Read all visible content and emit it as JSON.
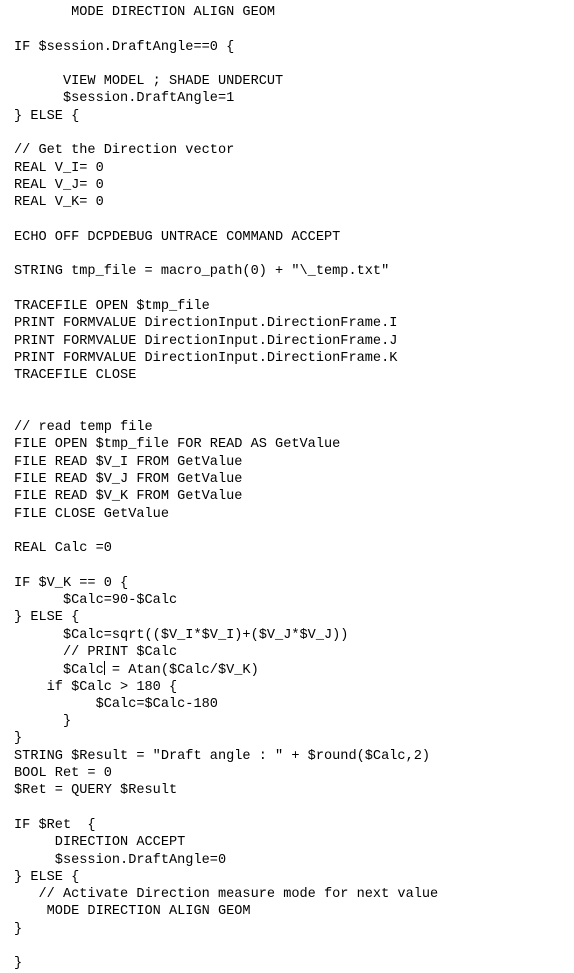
{
  "editor": {
    "kind": "plain-text-code-listing",
    "language": "CAD macro script",
    "foreground_color": "#000000",
    "background_color": "#ffffff",
    "caret": {
      "visible": true,
      "line_index": 38,
      "after_text": "$Calc"
    },
    "lines": [
      "       MODE DIRECTION ALIGN GEOM",
      "",
      "IF $session.DraftAngle==0 {",
      "",
      "      VIEW MODEL ; SHADE UNDERCUT",
      "      $session.DraftAngle=1",
      "} ELSE {",
      "",
      "// Get the Direction vector",
      "REAL V_I= 0",
      "REAL V_J= 0",
      "REAL V_K= 0",
      "",
      "ECHO OFF DCPDEBUG UNTRACE COMMAND ACCEPT",
      "",
      "STRING tmp_file = macro_path(0) + \"\\_temp.txt\"",
      "",
      "TRACEFILE OPEN $tmp_file",
      "PRINT FORMVALUE DirectionInput.DirectionFrame.I",
      "PRINT FORMVALUE DirectionInput.DirectionFrame.J",
      "PRINT FORMVALUE DirectionInput.DirectionFrame.K",
      "TRACEFILE CLOSE",
      "",
      "",
      "// read temp file",
      "FILE OPEN $tmp_file FOR READ AS GetValue",
      "FILE READ $V_I FROM GetValue",
      "FILE READ $V_J FROM GetValue",
      "FILE READ $V_K FROM GetValue",
      "FILE CLOSE GetValue",
      "",
      "REAL Calc =0",
      "",
      "IF $V_K == 0 {",
      "      $Calc=90-$Calc",
      "} ELSE {",
      "      $Calc=sqrt(($V_I*$V_I)+($V_J*$V_J))",
      "      // PRINT $Calc",
      "      $Calc = Atan($Calc/$V_K)",
      "    if $Calc > 180 {",
      "          $Calc=$Calc-180",
      "      }",
      "}",
      "STRING $Result = \"Draft angle : \" + $round($Calc,2)",
      "BOOL Ret = 0",
      "$Ret = QUERY $Result",
      "",
      "IF $Ret  {",
      "     DIRECTION ACCEPT",
      "     $session.DraftAngle=0",
      "} ELSE {",
      "   // Activate Direction measure mode for next value",
      "    MODE DIRECTION ALIGN GEOM",
      "}",
      "",
      "}"
    ]
  }
}
